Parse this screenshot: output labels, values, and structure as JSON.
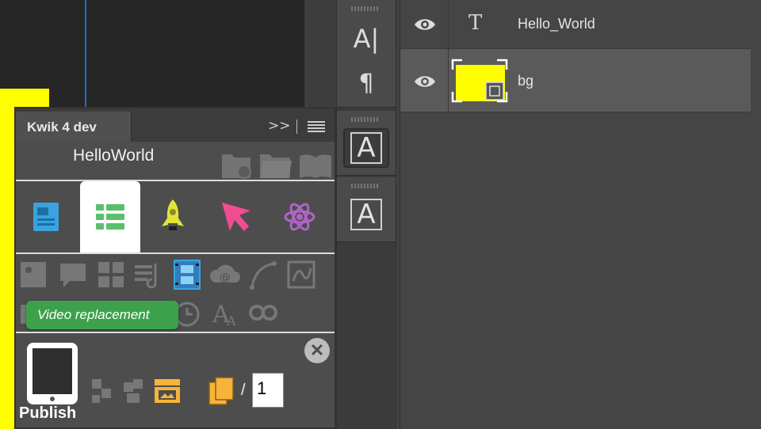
{
  "canvas": {
    "shape_color": "#ffff00",
    "guide_color": "#1f6fc4"
  },
  "tools": {
    "text_tool_glyph": "A|",
    "paragraph_tool_glyph": "¶",
    "char_style_glyph": "A",
    "para_style_glyph": "A"
  },
  "layers": {
    "items": [
      {
        "name": "Hello_World",
        "kind": "text",
        "icon": "text-layer-icon",
        "selected": false
      },
      {
        "name": "bg",
        "kind": "shape",
        "icon": "yellow-thumbnail",
        "selected": true,
        "color": "#ffff00"
      }
    ]
  },
  "kwik": {
    "tab_label": "Kwik 4 dev",
    "expand_glyph": ">>",
    "project_name": "HelloWorld",
    "categories": [
      {
        "icon": "project-page-icon",
        "color": "#3aa3df",
        "active": false
      },
      {
        "icon": "list-grid-icon",
        "color": "#5bbf6a",
        "active": true
      },
      {
        "icon": "rocket-icon",
        "color": "#e3e33a",
        "active": false
      },
      {
        "icon": "pointer-arrow-icon",
        "color": "#f04c8f",
        "active": false
      },
      {
        "icon": "atom-icon",
        "color": "#b064c8",
        "active": false
      }
    ],
    "tooltip": "Video replacement",
    "publish_label": "Publish",
    "close_glyph": "✕",
    "page_separator": "/",
    "page_value": "1",
    "accent_orange": "#f6b43a"
  }
}
